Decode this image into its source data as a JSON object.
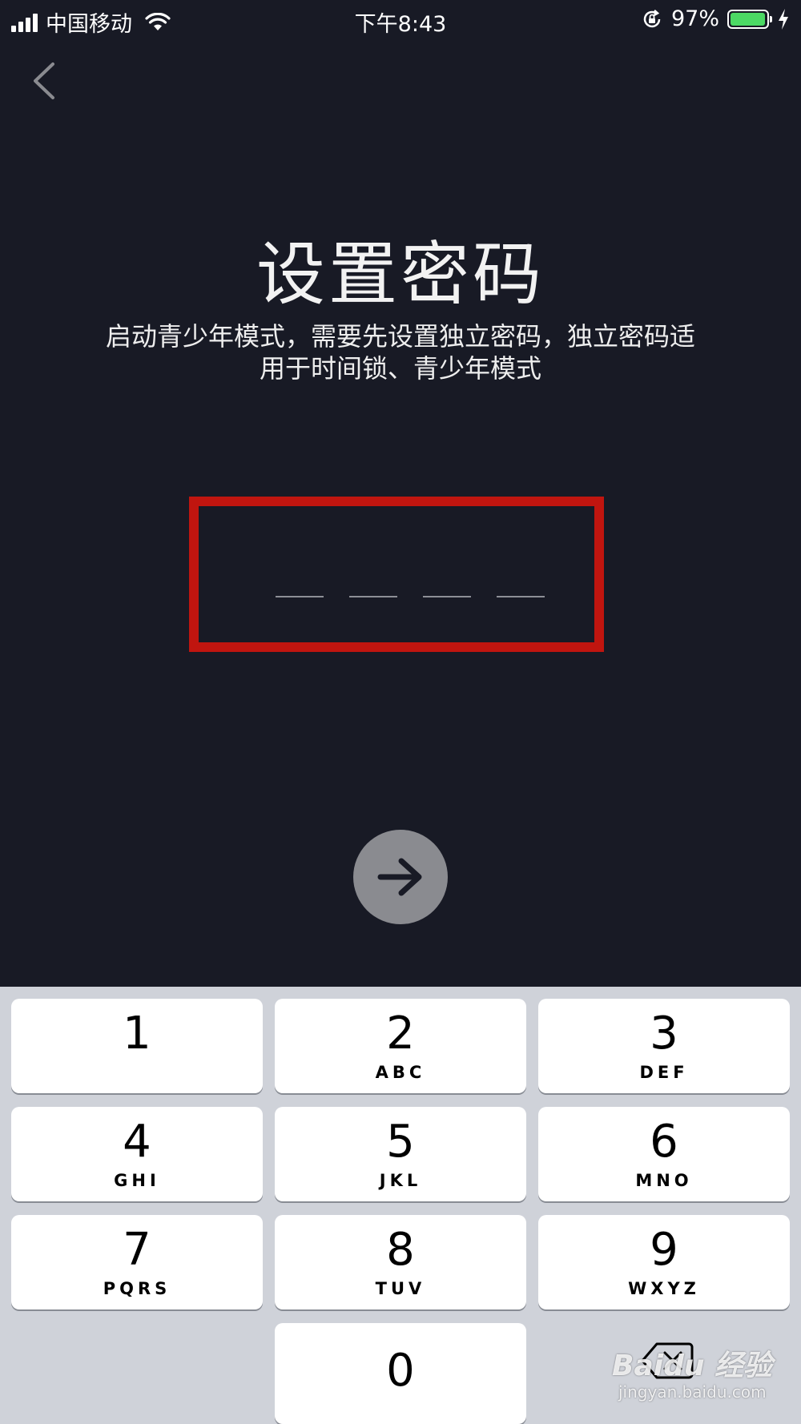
{
  "status_bar": {
    "carrier": "中国移动",
    "time": "下午8:43",
    "battery_percent": "97%",
    "battery_level": 0.97,
    "icons": [
      "signal-icon",
      "wifi-icon",
      "orientation-lock-icon",
      "battery-icon",
      "charging-icon"
    ]
  },
  "nav": {
    "back_icon": "chevron-left-icon"
  },
  "header": {
    "title": "设置密码",
    "subtitle_line1": "启动青少年模式，需要先设置独立密码，独立密码适",
    "subtitle_line2": "用于时间锁、青少年模式"
  },
  "code_input": {
    "length": 4,
    "value": "",
    "highlight_color": "#c0150f"
  },
  "next_button": {
    "icon": "arrow-right-icon",
    "enabled": false
  },
  "keypad": {
    "keys": [
      {
        "digit": "1",
        "letters": ""
      },
      {
        "digit": "2",
        "letters": "ABC"
      },
      {
        "digit": "3",
        "letters": "DEF"
      },
      {
        "digit": "4",
        "letters": "GHI"
      },
      {
        "digit": "5",
        "letters": "JKL"
      },
      {
        "digit": "6",
        "letters": "MNO"
      },
      {
        "digit": "7",
        "letters": "PQRS"
      },
      {
        "digit": "8",
        "letters": "TUV"
      },
      {
        "digit": "9",
        "letters": "WXYZ"
      },
      {
        "digit": "0",
        "letters": ""
      }
    ],
    "delete_icon": "backspace-icon"
  },
  "watermark": {
    "brand": "Baidu 经验",
    "url": "jingyan.baidu.com"
  },
  "colors": {
    "background": "#181a25",
    "keypad_background": "#cfd2d9",
    "battery_green": "#4cd964",
    "next_button": "#8a8b90"
  }
}
